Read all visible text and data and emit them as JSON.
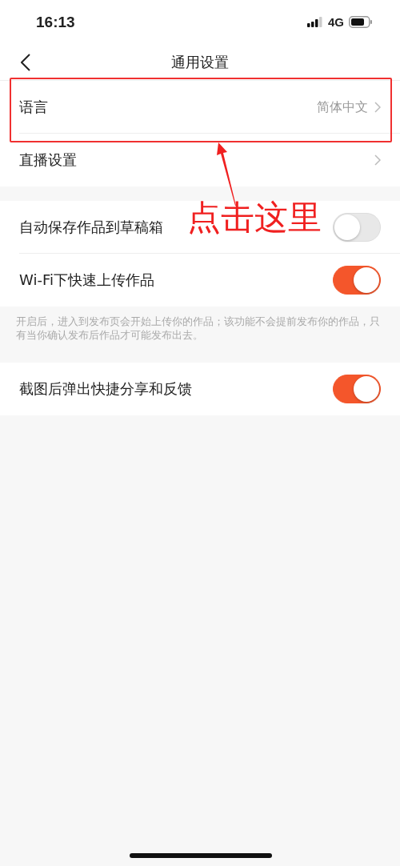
{
  "status_bar": {
    "time": "16:13",
    "network": "4G"
  },
  "nav": {
    "title": "通用设置"
  },
  "groups": [
    {
      "rows": [
        {
          "kind": "link",
          "label": "语言",
          "value": "简体中文"
        },
        {
          "kind": "link",
          "label": "直播设置"
        }
      ]
    },
    {
      "rows": [
        {
          "kind": "toggle",
          "label": "自动保存作品到草稿箱",
          "on": false
        },
        {
          "kind": "toggle",
          "label": "Wi-Fi下快速上传作品",
          "on": true
        }
      ],
      "note": "开启后，进入到发布页会开始上传你的作品；该功能不会提前发布你的作品，只有当你确认发布后作品才可能发布出去。"
    },
    {
      "rows": [
        {
          "kind": "toggle",
          "label": "截图后弹出快捷分享和反馈",
          "on": true
        }
      ]
    }
  ],
  "annotation": {
    "text": "点击这里"
  }
}
